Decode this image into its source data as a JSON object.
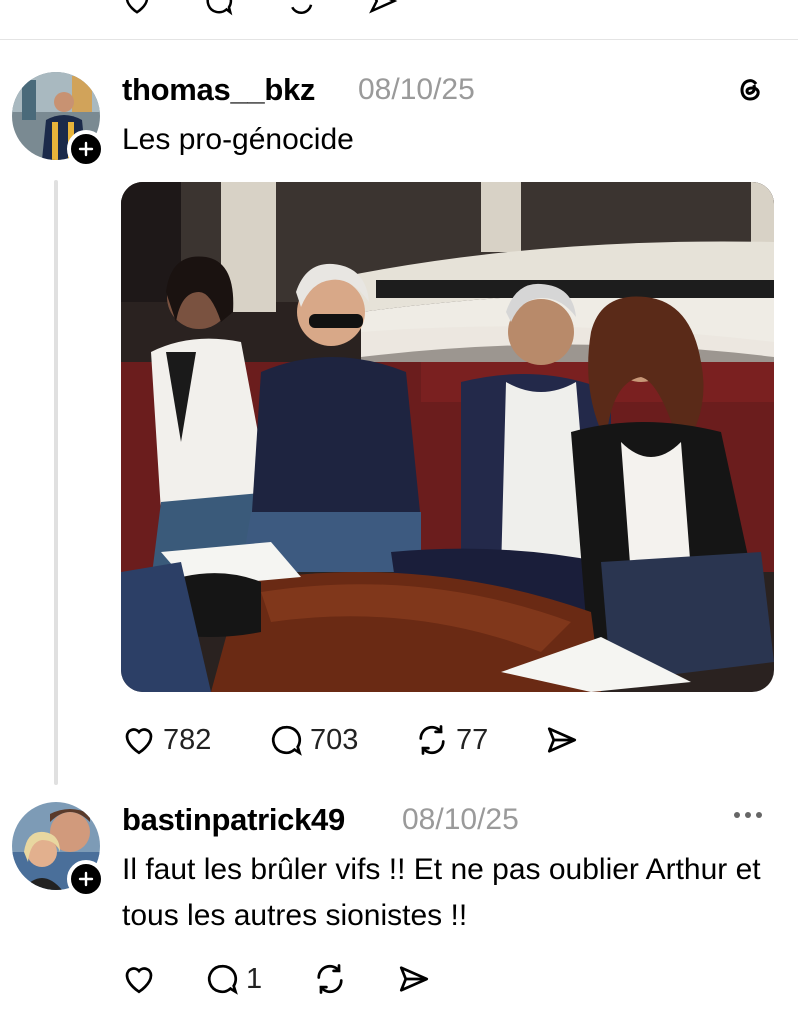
{
  "top_actions": [
    "like-icon",
    "reply-icon",
    "repost-icon",
    "share-icon"
  ],
  "post1": {
    "username": "thomas__bkz",
    "date": "08/10/25",
    "text": "Les pro-génocide",
    "app_icon": "threads-logo-icon",
    "stats": {
      "likes": "782",
      "replies": "703",
      "reposts": "77"
    }
  },
  "post2": {
    "username": "bastinpatrick49",
    "date": "08/10/25",
    "text": "Il faut les brûler vifs !! Et ne pas oublier Arthur et tous les autres sionistes !!",
    "stats": {
      "replies": "1"
    }
  },
  "colors": {
    "text": "#000000",
    "muted": "#9a9a9a",
    "divider": "#e4e4e4",
    "thread": "#e0e0e0"
  }
}
